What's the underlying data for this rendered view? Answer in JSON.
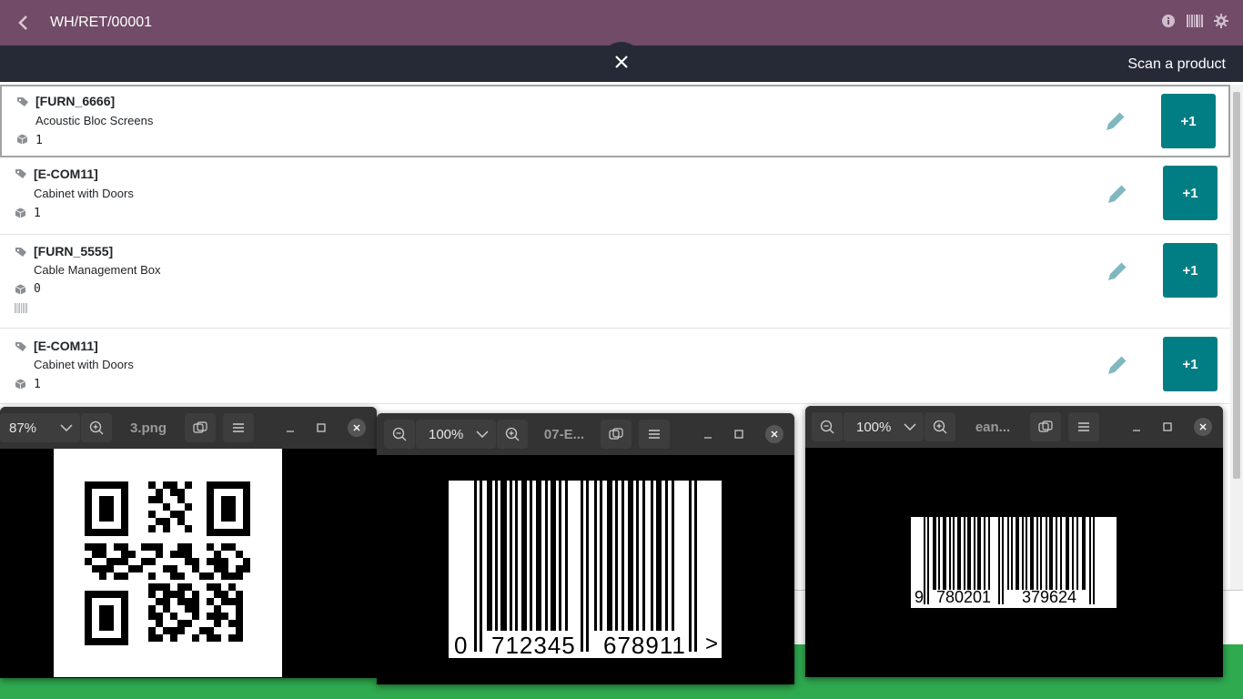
{
  "header": {
    "title": "WH/RET/00001"
  },
  "subbar": {
    "message": "Scan a product"
  },
  "lines": [
    {
      "ref": "[FURN_6666]",
      "name": "Acoustic Bloc Screens",
      "qty": "1",
      "plus_label": "+1"
    },
    {
      "ref": "[E-COM11]",
      "name": "Cabinet with Doors",
      "qty": "1",
      "plus_label": "+1"
    },
    {
      "ref": "[FURN_5555]",
      "name": "Cable Management Box",
      "qty": "0",
      "plus_label": "+1"
    },
    {
      "ref": "[E-COM11]",
      "name": "Cabinet with Doors",
      "qty": "1",
      "plus_label": "+1"
    }
  ],
  "viewers": [
    {
      "zoom": "87%",
      "filename": "3.png"
    },
    {
      "zoom": "100%",
      "filename": "07-E...",
      "barcode_text": {
        "first": "0",
        "left": "712345",
        "right": "678911",
        "end": ">"
      }
    },
    {
      "zoom": "100%",
      "filename": "ean...",
      "barcode_text": {
        "first": "9",
        "left": "780201",
        "right": "379624"
      }
    }
  ],
  "colors": {
    "brand": "#714b67",
    "subbar": "#262a36",
    "accent": "#017e84"
  }
}
